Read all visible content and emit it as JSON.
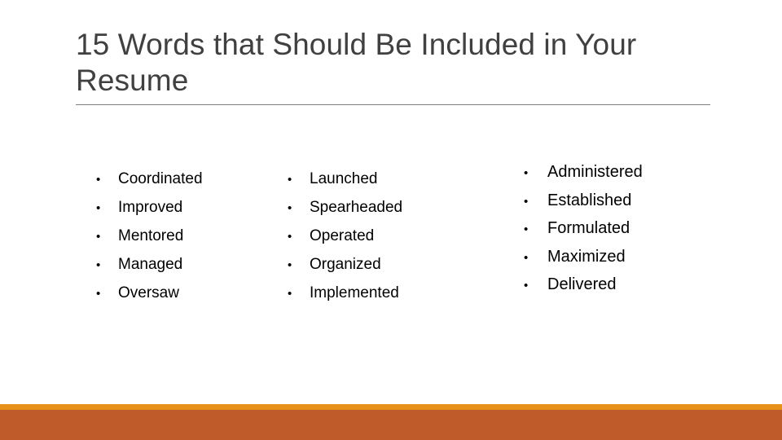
{
  "slide": {
    "title": "15 Words that Should Be Included in Your Resume",
    "background_color": "#ffffff",
    "title_color": "#404040",
    "rule_color": "#7f7f7f"
  },
  "columns": [
    {
      "name": "column-1",
      "bullet_glyph": "•",
      "items": [
        "Coordinated",
        "Improved",
        "Mentored",
        "Managed",
        "Oversaw"
      ]
    },
    {
      "name": "column-2",
      "bullet_glyph": "•",
      "items": [
        "Launched",
        "Spearheaded",
        "Operated",
        "Organized",
        "Implemented"
      ]
    },
    {
      "name": "column-3",
      "bullet_glyph": "•",
      "items": [
        "Administered",
        "Established",
        "Formulated",
        "Maximized",
        "Delivered"
      ]
    }
  ],
  "footer": {
    "accent_bar_color": "#e8911a",
    "main_bar_color": "#bf5b2b"
  }
}
